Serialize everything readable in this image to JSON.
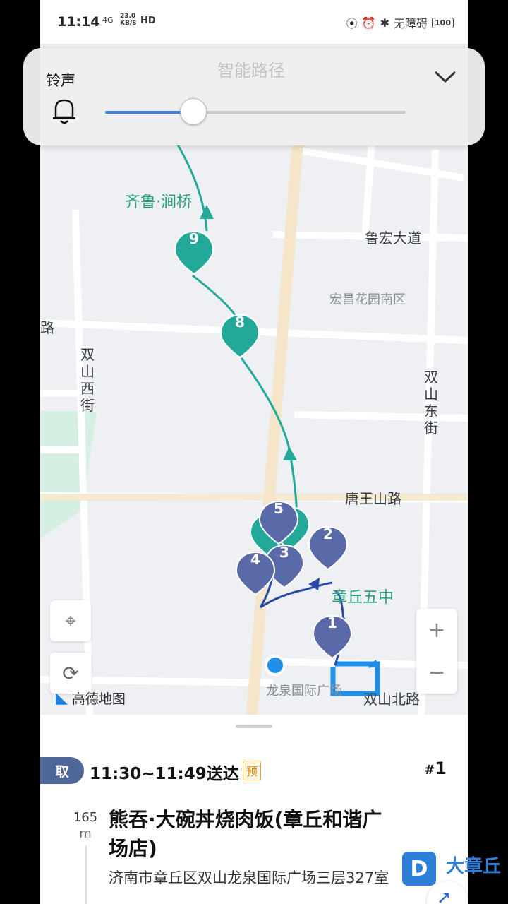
{
  "status_bar": {
    "time": "11:14",
    "network": "4G",
    "speed_value": "23.0",
    "speed_unit": "KB/S",
    "hd": "HD",
    "accessibility": "无障碍",
    "battery": "100"
  },
  "volume_overlay": {
    "title": "铃声",
    "ghost_header": "智能路径",
    "level": 0.29
  },
  "map": {
    "road_labels": {
      "luhong": "鲁宏大道",
      "tangwangshan": "唐王山路",
      "shuangshan_north": "双山北路",
      "lu_edge": "路",
      "shuangshan_west": "双山西街",
      "shuangshan_east": "双山东街"
    },
    "poi_labels": {
      "qilu": "齐鲁·涧桥",
      "zhangqiu_5": "章丘五中",
      "hongchang": "宏昌花园南区",
      "longquan": "龙泉国际广场"
    },
    "markers": [
      "1",
      "2",
      "3",
      "4",
      "5",
      "8",
      "9"
    ],
    "attribution": "高德地图",
    "zoom_in": "+",
    "zoom_out": "−"
  },
  "order": {
    "pickup_tag": "取",
    "delivery_window": "11:30~11:49送达",
    "pre_badge": "预",
    "order_number_prefix": "#",
    "order_number": "1",
    "distance_value": "165",
    "distance_unit": "m",
    "shop_name": "熊吞·大碗丼烧肉饭(章丘和谐广场店)",
    "address": "济南市章丘区双山龙泉国际广场三层327室"
  },
  "watermark": {
    "logo": "D",
    "name": "大章丘"
  }
}
